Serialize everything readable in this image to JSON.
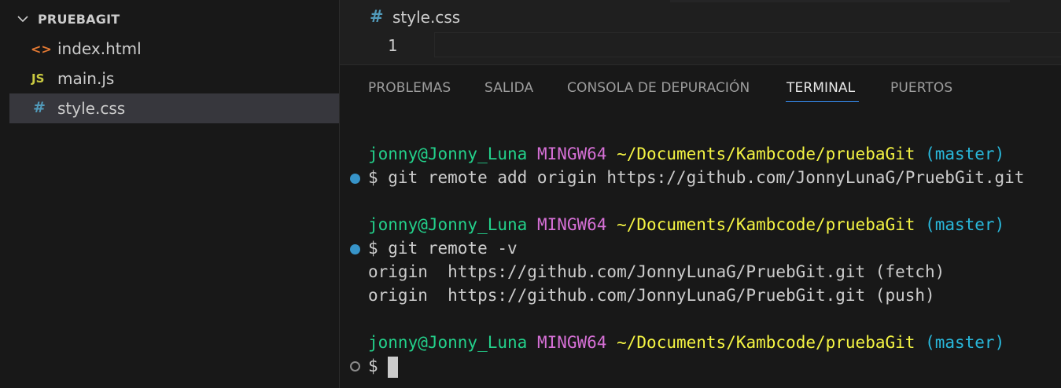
{
  "explorer": {
    "folder_name": "PRUEBAGIT",
    "files": [
      {
        "icon": "<>",
        "label": "index.html",
        "icon_color": "#e37933"
      },
      {
        "icon": "JS",
        "label": "main.js",
        "icon_color": "#cbcb41"
      },
      {
        "icon": "#",
        "label": "style.css",
        "icon_color": "#519aba"
      }
    ],
    "selected_file": "style.css"
  },
  "editor": {
    "tab_icon": "#",
    "tab_name": "style.css",
    "line_number": "1"
  },
  "panel": {
    "tabs": [
      "PROBLEMAS",
      "SALIDA",
      "CONSOLA DE DEPURACIÓN",
      "TERMINAL",
      "PUERTOS"
    ],
    "active_tab": "TERMINAL"
  },
  "terminal": {
    "prompt": {
      "user": "jonny@Jonny_Luna",
      "system": "MINGW64",
      "path": "~/Documents/Kambcode/pruebaGit",
      "branch": "(master)"
    },
    "commands": [
      "$ git remote add origin https://github.com/JonnyLunaG/PruebGit.git",
      "$ git remote -v",
      "$ "
    ],
    "output": [
      "origin  https://github.com/JonnyLunaG/PruebGit.git (fetch)",
      "origin  https://github.com/JonnyLunaG/PruebGit.git (push)"
    ]
  },
  "colors": {
    "user": "#23d18b",
    "system": "#d670d6",
    "path": "#f5f543",
    "branch": "#29b8db",
    "accent": "#3794ff"
  }
}
